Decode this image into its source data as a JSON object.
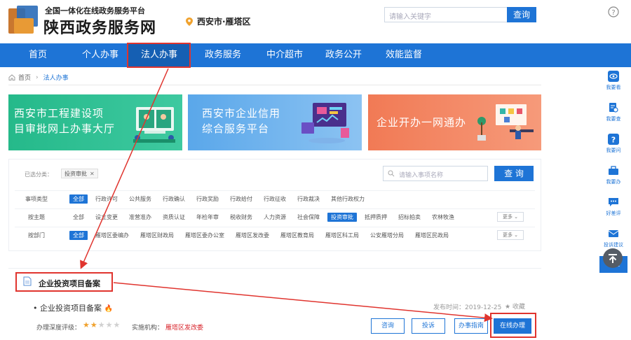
{
  "header": {
    "subtitle": "全国一体化在线政务服务平台",
    "title": "陕西政务服务网",
    "location": "西安市·雁塔区",
    "search_placeholder": "请输入关键字",
    "search_button": "查询"
  },
  "nav": [
    "首页",
    "个人办事",
    "法人办事",
    "政务服务",
    "中介超市",
    "政务公开",
    "效能监督"
  ],
  "breadcrumb": {
    "home": "首页",
    "current": "法人办事"
  },
  "banners": {
    "green": [
      "西安市工程建设项",
      "目审批网上办事大厅"
    ],
    "blue": [
      "西安市企业信用",
      "综合服务平台"
    ],
    "orange": "企业开办一网通办"
  },
  "filter": {
    "selected_label": "已选分类：",
    "selected_tag": "投资审批",
    "search_placeholder": "请输入事项名称",
    "search_button": "查 询",
    "more": "更多 ⌄",
    "rows": [
      {
        "label": "事项类型",
        "options": [
          "全部",
          "行政许可",
          "公共服务",
          "行政确认",
          "行政奖励",
          "行政给付",
          "行政征收",
          "行政裁决",
          "其他行政权力"
        ],
        "active": 0
      },
      {
        "label": "按主题",
        "options": [
          "全部",
          "设立变更",
          "准营准办",
          "资质认证",
          "年检年审",
          "税收财务",
          "人力资源",
          "社会保障",
          "投资审批",
          "抵押质押",
          "招标拍卖",
          "农林牧渔"
        ],
        "active": 8
      },
      {
        "label": "按部门",
        "options": [
          "全部",
          "雁塔区委编办",
          "雁塔区财政局",
          "雁塔区委办公室",
          "雁塔区发改委",
          "雁塔区教育局",
          "雁塔区科工局",
          "公安雁塔分局",
          "雁塔区民政局"
        ],
        "active": 0
      }
    ]
  },
  "result": {
    "section_title": "企业投资项目备案",
    "item_name": "• 企业投资项目备案",
    "date": "发布时间：2019-12-25",
    "fav": "★ 收藏",
    "rating_label": "办理深度评级：",
    "rating": 2,
    "rating_max": 5,
    "org_label": "实施机构：",
    "org_value": "雁塔区发改委",
    "buttons": [
      "咨询",
      "投诉",
      "办事指南",
      "在线办理"
    ]
  },
  "sidebar": {
    "items": [
      "我要看",
      "我要查",
      "我要问",
      "我要办",
      "好差评",
      "投诉建议"
    ],
    "collapse": "收起"
  },
  "colors": {
    "primary": "#1e74d6",
    "annotation_red": "#e0342e"
  }
}
